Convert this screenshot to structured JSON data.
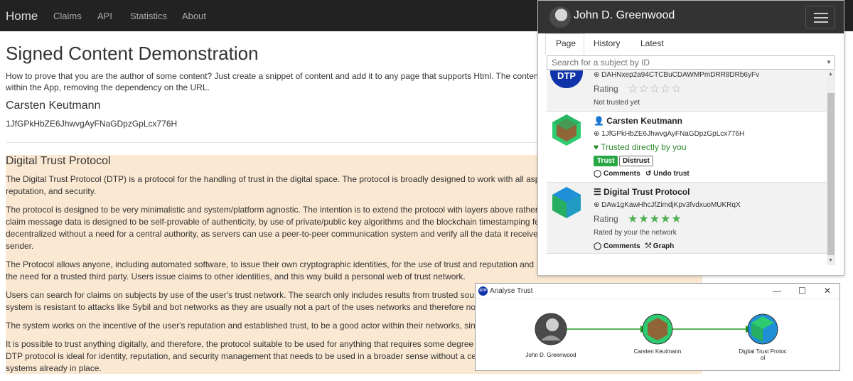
{
  "nav": {
    "brand": "Home",
    "links": [
      "Claims",
      "API",
      "Statistics",
      "About"
    ]
  },
  "main": {
    "title": "Signed Content Demonstration",
    "intro_line1": "How to prove that you are the author of some content? Just create a snippet of content and add it to any page that supports Html. The conten",
    "intro_line2": "within the App, removing the dependency on the URL.",
    "author_name": "Carsten Keutmann",
    "author_id": "1JfGPkHbZE6JhwvgAyFNaGDpzGpLcx776H"
  },
  "signed": {
    "title": "Digital Trust Protocol",
    "lines": [
      "The Digital Trust Protocol (DTP) is a protocol for the handling of trust in the digital space. The protocol is broadly designed to work with all asp",
      "reputation, and security.",
      "The protocol is designed to be very minimalistic and system/platform agnostic. The intention is to extend the protocol with layers above rather",
      "claim message data is designed to be self-provable of authenticity, by use of private/public key algorithms and the blockchain timestamping fe",
      "decentralized without a need for a central authority, as servers can use a peer-to-peer communication system and verify all the data it receive",
      "sender.",
      "The Protocol allows anyone, including automated software, to issue their own cryptographic identities, for the use of trust and reputation and",
      "the need for a trusted third party. Users issue claims to other identities, and this way build a personal web of trust network.",
      "Users can search for claims on subjects by use of the user's trust network. The search only includes results from trusted sou",
      "system is resistant to attacks like Sybil and bot networks as they are usually not a part of the uses networks and therefore no",
      "The system works on the incentive of the user's reputation and established trust, to be a good actor within their networks, sin",
      "It is possible to trust anything digitally, and therefore, the protocol suitable to be used for anything that requires some degree",
      "DTP protocol is ideal for identity, reputation, and security management that needs to be used in a broader sense without a ce",
      "systems already in place."
    ]
  },
  "panel": {
    "user_name": "John D. Greenwood",
    "tabs": [
      "Page",
      "History",
      "Latest"
    ],
    "search_placeholder": "Search for a subject by ID",
    "items": [
      {
        "address": "DAHNxep2a94CTCBuCDAWMPmDRR8DRb6yFv",
        "rating_label": "Rating",
        "stars": "☆☆☆☆☆",
        "status": "Not trusted yet",
        "thumb_text": "DTP"
      },
      {
        "name": "Carsten Keutmann",
        "address": "1JfGPkHbZE6JhwvgAyFNaGDpzGpLcx776H",
        "trusted": "Trusted directly by you",
        "trust_btn": "Trust",
        "distrust_btn": "Distrust",
        "comments": "Comments",
        "undo": "Undo trust"
      },
      {
        "name": "Digital Trust Protocol",
        "address": "DAw1gKawHhcJfZimdjKpv3fvdxuoMUKRqX",
        "rating_label": "Rating",
        "stars": "★★★★★",
        "status": "Rated by your the network",
        "comments": "Comments",
        "graph": "Graph"
      }
    ]
  },
  "analyse": {
    "title": "Analyse Trust",
    "logo": "DTP",
    "nodes": [
      "John D. Greenwood",
      "Carsten Keutmann",
      "Digital Trust Protoc\nol"
    ]
  },
  "colors": {
    "navbar": "#222222",
    "signed_bg": "#fbe8d2",
    "trust_green": "#28a745",
    "edge_green": "#1e9b1e"
  }
}
